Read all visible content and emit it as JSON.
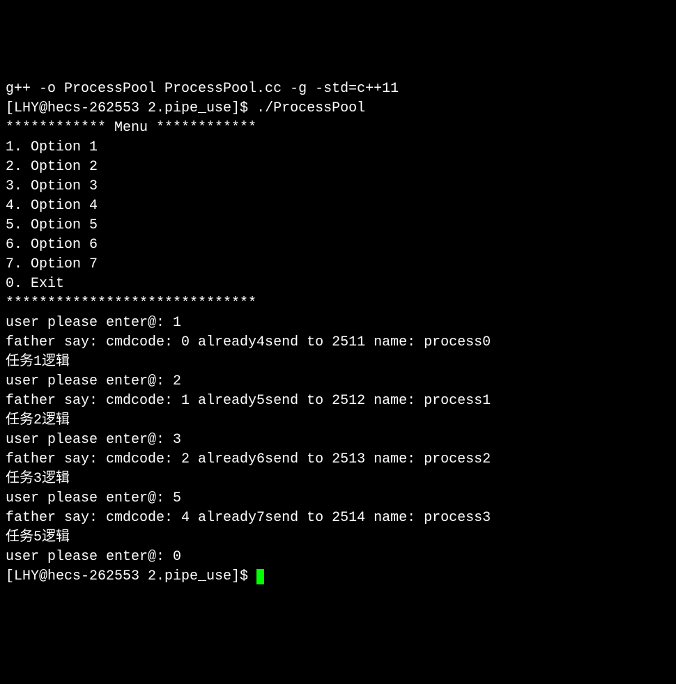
{
  "compile_cmd": "g++ -o ProcessPool ProcessPool.cc -g -std=c++11",
  "prompt1": "[LHY@hecs-262553 2.pipe_use]$ ",
  "run_cmd": "./ProcessPool",
  "menu_header": "************ Menu ************",
  "menu_items": [
    "1. Option 1",
    "2. Option 2",
    "3. Option 3",
    "4. Option 4",
    "5. Option 5",
    "6. Option 6",
    "7. Option 7",
    "0. Exit"
  ],
  "menu_footer": "******************************",
  "interactions": [
    {
      "enter": "user please enter@: 1",
      "father": "father say: cmdcode: 0 already4send to 2511 name: process0",
      "task": "任务1逻辑"
    },
    {
      "enter": "user please enter@: 2",
      "father": "father say: cmdcode: 1 already5send to 2512 name: process1",
      "task": "任务2逻辑"
    },
    {
      "enter": "user please enter@: 3",
      "father": "father say: cmdcode: 2 already6send to 2513 name: process2",
      "task": "任务3逻辑"
    },
    {
      "enter": "user please enter@: 5",
      "father": "father say: cmdcode: 4 already7send to 2514 name: process3",
      "task": "任务5逻辑"
    }
  ],
  "final_enter": "user please enter@: 0",
  "prompt2": "[LHY@hecs-262553 2.pipe_use]$ "
}
